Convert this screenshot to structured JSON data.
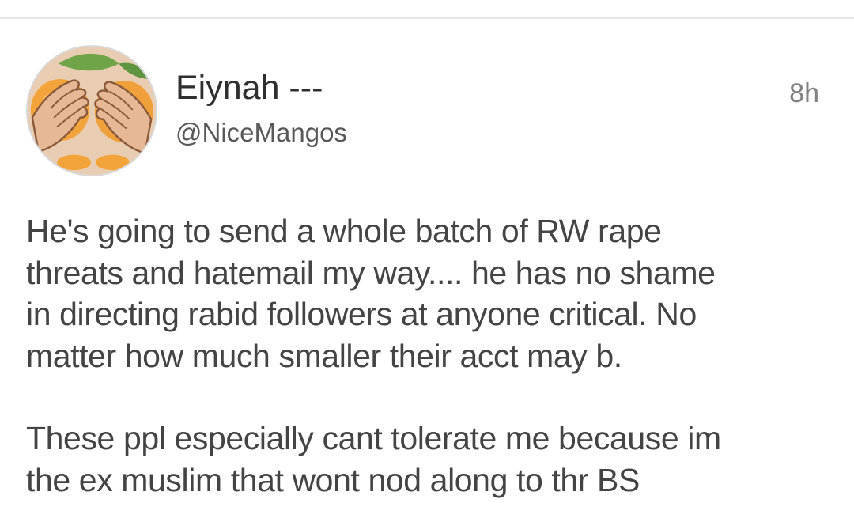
{
  "tweet": {
    "author": {
      "display_name": "Eiynah ---",
      "handle": "@NiceMangos",
      "avatar_icon": "mango-hands-avatar"
    },
    "timestamp": "8h",
    "paragraphs": [
      "He's going to send a whole batch of RW rape\nthreats and hatemail my way.... he has no shame\nin directing rabid followers at anyone critical. No\nmatter how much smaller their acct may b.",
      "These ppl especially cant tolerate me because im\nthe ex muslim that wont nod along to thr BS"
    ]
  },
  "colors": {
    "text_primary": "#2f2f2f",
    "text_body": "#444444",
    "text_secondary": "#585858",
    "timestamp": "#808080",
    "divider": "#e6e6e6",
    "avatar_bg": "#e8cdb2",
    "mango_orange": "#f2a43a",
    "leaf_green": "#6fa548"
  }
}
